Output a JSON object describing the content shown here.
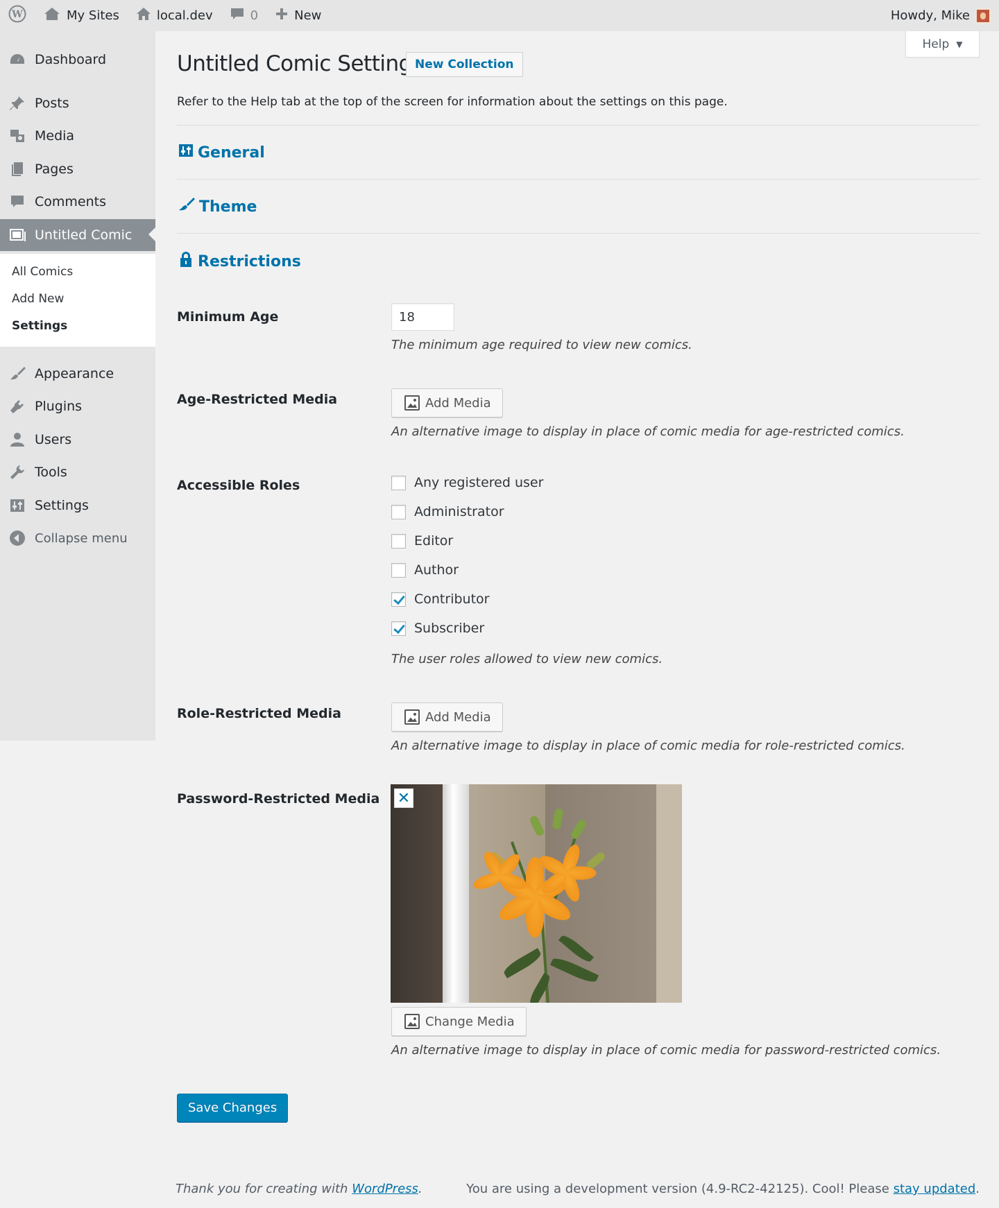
{
  "admin_bar": {
    "my_sites": "My Sites",
    "site_name": "local.dev",
    "comments_count": "0",
    "new_label": "New",
    "greeting": "Howdy, Mike"
  },
  "sidebar": {
    "items": [
      {
        "label": "Dashboard"
      },
      {
        "label": "Posts"
      },
      {
        "label": "Media"
      },
      {
        "label": "Pages"
      },
      {
        "label": "Comments"
      },
      {
        "label": "Untitled Comic"
      },
      {
        "label": "Appearance"
      },
      {
        "label": "Plugins"
      },
      {
        "label": "Users"
      },
      {
        "label": "Tools"
      },
      {
        "label": "Settings"
      },
      {
        "label": "Collapse menu"
      }
    ],
    "submenu": [
      {
        "label": "All Comics"
      },
      {
        "label": "Add New"
      },
      {
        "label": "Settings"
      }
    ]
  },
  "help_tab": "Help",
  "page": {
    "title": "Untitled Comic Settings",
    "title_action": "New Collection",
    "intro": "Refer to the Help tab at the top of the screen for information about the settings on this page."
  },
  "sections": {
    "general": "General",
    "theme": "Theme",
    "restrictions": "Restrictions"
  },
  "fields": {
    "minimum_age": {
      "label": "Minimum Age",
      "value": "18",
      "description": "The minimum age required to view new comics."
    },
    "age_media": {
      "label": "Age-Restricted Media",
      "button": "Add Media",
      "description": "An alternative image to display in place of comic media for age-restricted comics."
    },
    "roles": {
      "label": "Accessible Roles",
      "options": [
        {
          "label": "Any registered user",
          "checked": false
        },
        {
          "label": "Administrator",
          "checked": false
        },
        {
          "label": "Editor",
          "checked": false
        },
        {
          "label": "Author",
          "checked": false
        },
        {
          "label": "Contributor",
          "checked": true
        },
        {
          "label": "Subscriber",
          "checked": true
        }
      ],
      "description": "The user roles allowed to view new comics."
    },
    "role_media": {
      "label": "Role-Restricted Media",
      "button": "Add Media",
      "description": "An alternative image to display in place of comic media for role-restricted comics."
    },
    "password_media": {
      "label": "Password-Restricted Media",
      "remove": "✕",
      "button": "Change Media",
      "description": "An alternative image to display in place of comic media for password-restricted comics."
    }
  },
  "save_button": "Save Changes",
  "footer": {
    "thanks_prefix": "Thank you for creating with ",
    "thanks_link": "WordPress",
    "thanks_suffix": ".",
    "version_prefix": "You are using a development version (4.9-RC2-42125). Cool! Please ",
    "version_link": "stay updated",
    "version_suffix": "."
  },
  "colors": {
    "accent": "#0073aa",
    "primary_button": "#0085ba",
    "sidebar_bg": "#e5e5e5",
    "current_menu_bg": "#888f95"
  }
}
